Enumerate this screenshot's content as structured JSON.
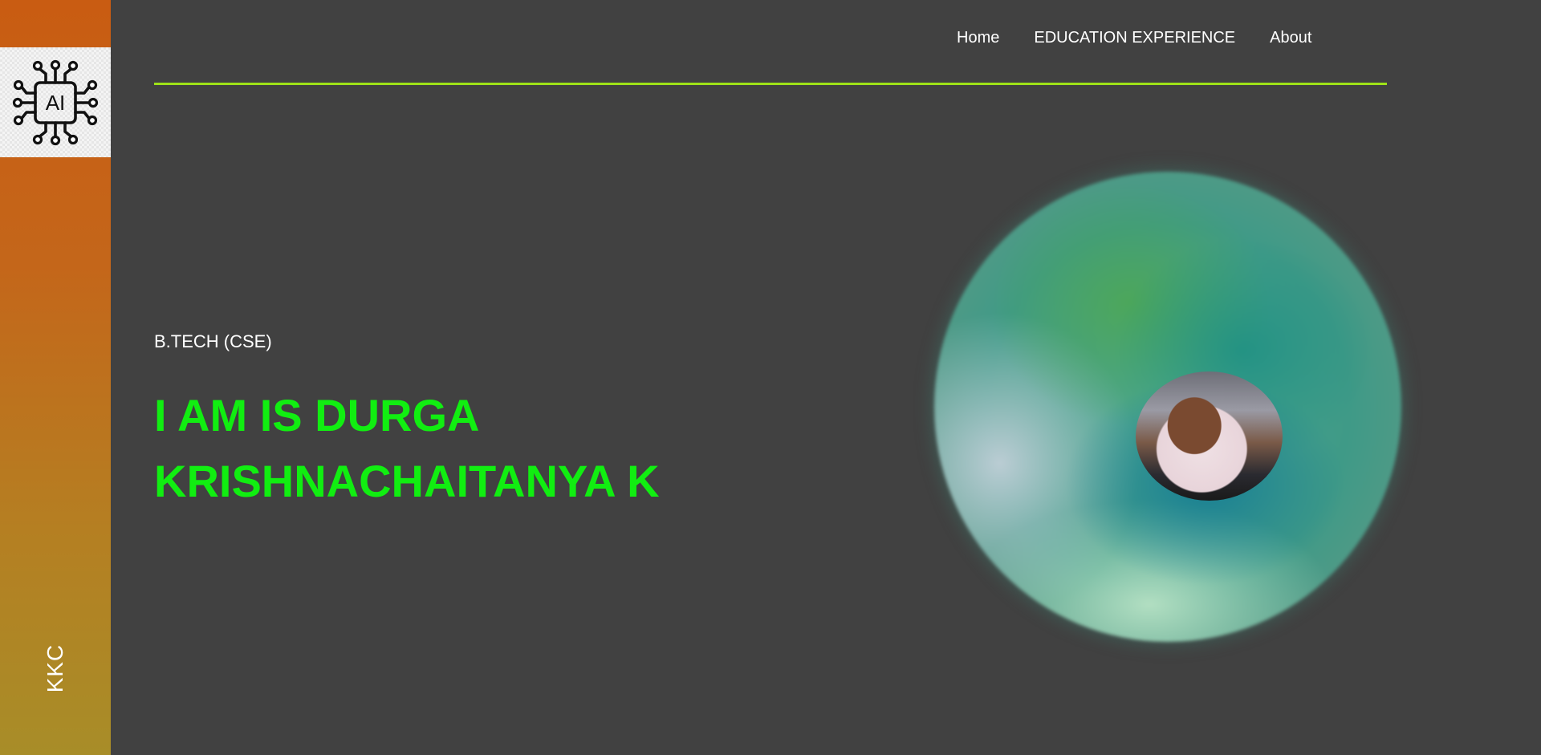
{
  "sidebar": {
    "logo_text": "AI",
    "brand": "KKC"
  },
  "nav": {
    "items": [
      {
        "label": "Home"
      },
      {
        "label": "EDUCATION EXPERIENCE"
      },
      {
        "label": "About"
      }
    ]
  },
  "hero": {
    "subtitle": "B.TECH (CSE)",
    "name_line1": "I AM IS DURGA",
    "name_line2": "KRISHNACHAITANYA K"
  },
  "colors": {
    "accent": "#11ee11",
    "divider": "#9ee218",
    "background": "#414141",
    "sidebar_top": "#c95c12",
    "sidebar_bottom": "#a88d28"
  },
  "icons": {
    "logo": "ai-chip-icon",
    "profile": "profile-photo"
  }
}
